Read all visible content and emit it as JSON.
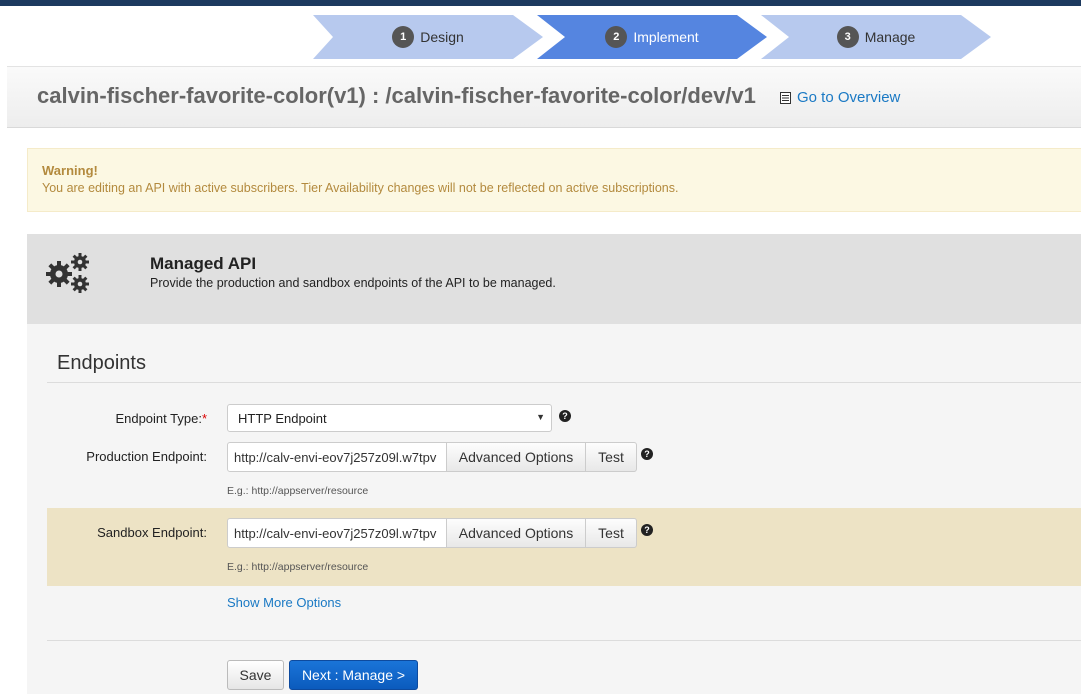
{
  "wizard": {
    "steps": [
      {
        "num": "1",
        "label": "Design"
      },
      {
        "num": "2",
        "label": "Implement"
      },
      {
        "num": "3",
        "label": "Manage"
      }
    ],
    "active_step": 2
  },
  "header": {
    "title": "calvin-fischer-favorite-color(v1) : /calvin-fischer-favorite-color/dev/v1",
    "overview_link": "Go to Overview"
  },
  "warning": {
    "title": "Warning!",
    "message": "You are editing an API with active subscribers. Tier Availability changes will not be reflected on active subscriptions."
  },
  "managed_api": {
    "title": "Managed API",
    "description": "Provide the production and sandbox endpoints of the API to be managed."
  },
  "endpoints": {
    "section_title": "Endpoints",
    "endpoint_type": {
      "label": "Endpoint Type:",
      "required_mark": "*",
      "value": "HTTP Endpoint"
    },
    "production": {
      "label": "Production Endpoint:",
      "value": "http://calv-envi-eov7j257z09l.w7tpv",
      "advanced_label": "Advanced Options",
      "test_label": "Test",
      "example": "E.g.: http://appserver/resource"
    },
    "sandbox": {
      "label": "Sandbox Endpoint:",
      "value": "http://calv-envi-eov7j257z09l.w7tpv",
      "advanced_label": "Advanced Options",
      "test_label": "Test",
      "example": "E.g.: http://appserver/resource"
    },
    "show_more": "Show More Options",
    "help_glyph": "?"
  },
  "actions": {
    "save": "Save",
    "next": "Next : Manage >"
  },
  "colors": {
    "accent": "#5585e0",
    "link": "#1a79c4",
    "primary_button": "#0b5bbd",
    "warning_bg": "#fcf8e3",
    "sandbox_row": "#ede3c5"
  }
}
